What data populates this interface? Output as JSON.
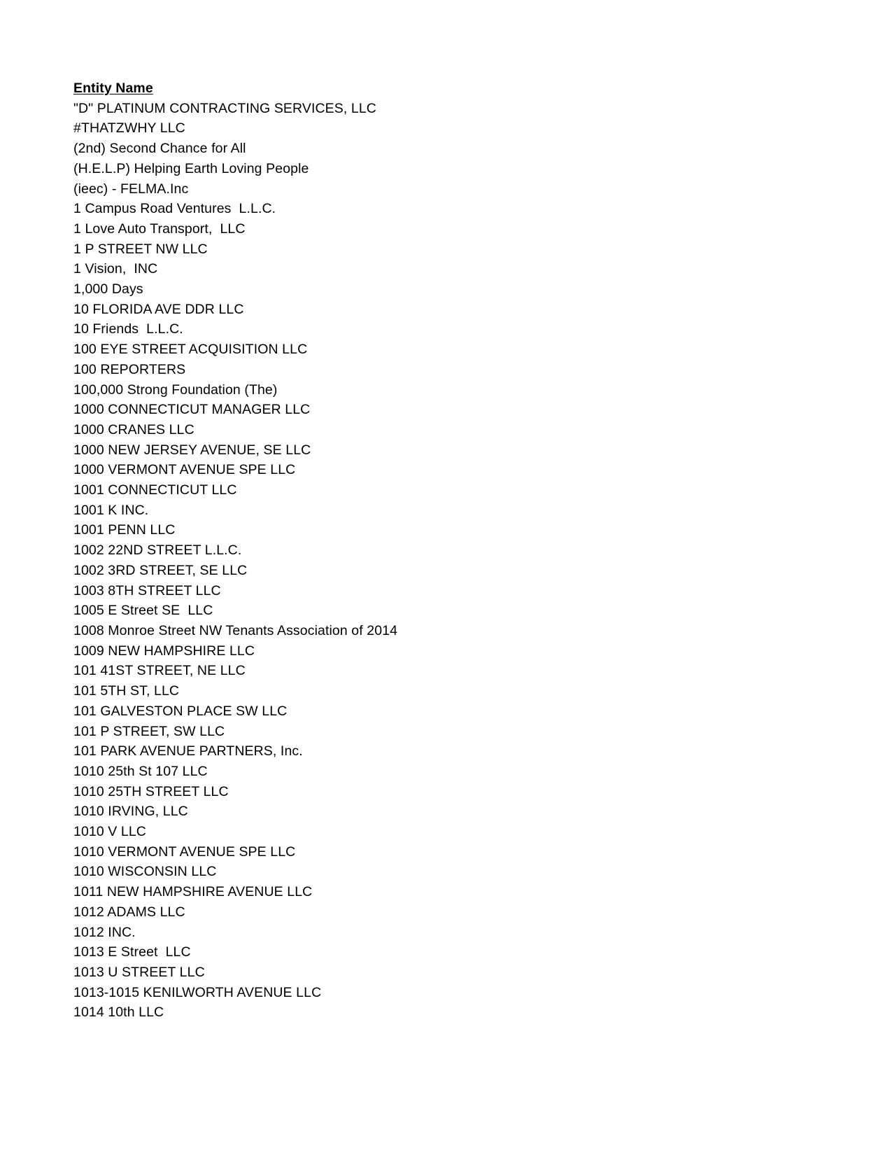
{
  "document": {
    "column_header": "Entity Name",
    "entities": [
      "\"D\" PLATINUM CONTRACTING SERVICES, LLC",
      "#THATZWHY LLC",
      "(2nd) Second Chance for All",
      "(H.E.L.P) Helping Earth Loving People",
      "(ieec) - FELMA.Inc",
      "1 Campus Road Ventures  L.L.C.",
      "1 Love Auto Transport,  LLC",
      "1 P STREET NW LLC",
      "1 Vision,  INC",
      "1,000 Days",
      "10 FLORIDA AVE DDR LLC",
      "10 Friends  L.L.C.",
      "100 EYE STREET ACQUISITION LLC",
      "100 REPORTERS",
      "100,000 Strong Foundation (The)",
      "1000 CONNECTICUT MANAGER LLC",
      "1000 CRANES LLC",
      "1000 NEW JERSEY AVENUE, SE LLC",
      "1000 VERMONT AVENUE SPE LLC",
      "1001 CONNECTICUT LLC",
      "1001 K INC.",
      "1001 PENN LLC",
      "1002 22ND STREET L.L.C.",
      "1002 3RD STREET, SE LLC",
      "1003 8TH STREET LLC",
      "1005 E Street SE  LLC",
      "1008 Monroe Street NW Tenants Association of 2014",
      "1009 NEW HAMPSHIRE LLC",
      "101 41ST STREET, NE LLC",
      "101 5TH ST, LLC",
      "101 GALVESTON PLACE SW LLC",
      "101 P STREET, SW LLC",
      "101 PARK AVENUE PARTNERS, Inc.",
      "1010 25th St 107 LLC",
      "1010 25TH STREET LLC",
      "1010 IRVING, LLC",
      "1010 V LLC",
      "1010 VERMONT AVENUE SPE LLC",
      "1010 WISCONSIN LLC",
      "1011 NEW HAMPSHIRE AVENUE LLC",
      "1012 ADAMS LLC",
      "1012 INC.",
      "1013 E Street  LLC",
      "1013 U STREET LLC",
      "1013-1015 KENILWORTH AVENUE LLC",
      "1014 10th LLC"
    ]
  }
}
